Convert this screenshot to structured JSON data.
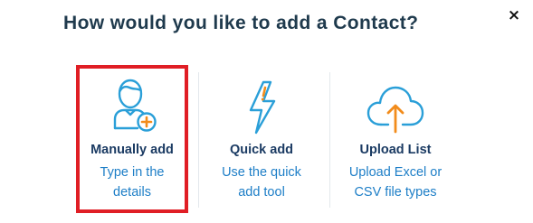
{
  "dialog": {
    "title": "How would you like to add a Contact?",
    "close_glyph": "×"
  },
  "options": [
    {
      "label": "Manually add",
      "desc_lines": [
        "Type in the",
        "details"
      ],
      "icon": "user-plus-icon",
      "selected": true
    },
    {
      "label": "Quick add",
      "desc_lines": [
        "Use the quick",
        "add tool"
      ],
      "icon": "lightning-bolt-icon",
      "selected": false
    },
    {
      "label": "Upload List",
      "desc_lines": [
        "Upload Excel or",
        "CSV file types"
      ],
      "icon": "cloud-upload-icon",
      "selected": false
    }
  ],
  "colors": {
    "title": "#1f3a4d",
    "label": "#1b3b63",
    "description": "#1d7ec7",
    "icon_blue": "#2a9fd8",
    "icon_orange": "#f28c1b",
    "selection_border": "#e01e25"
  }
}
